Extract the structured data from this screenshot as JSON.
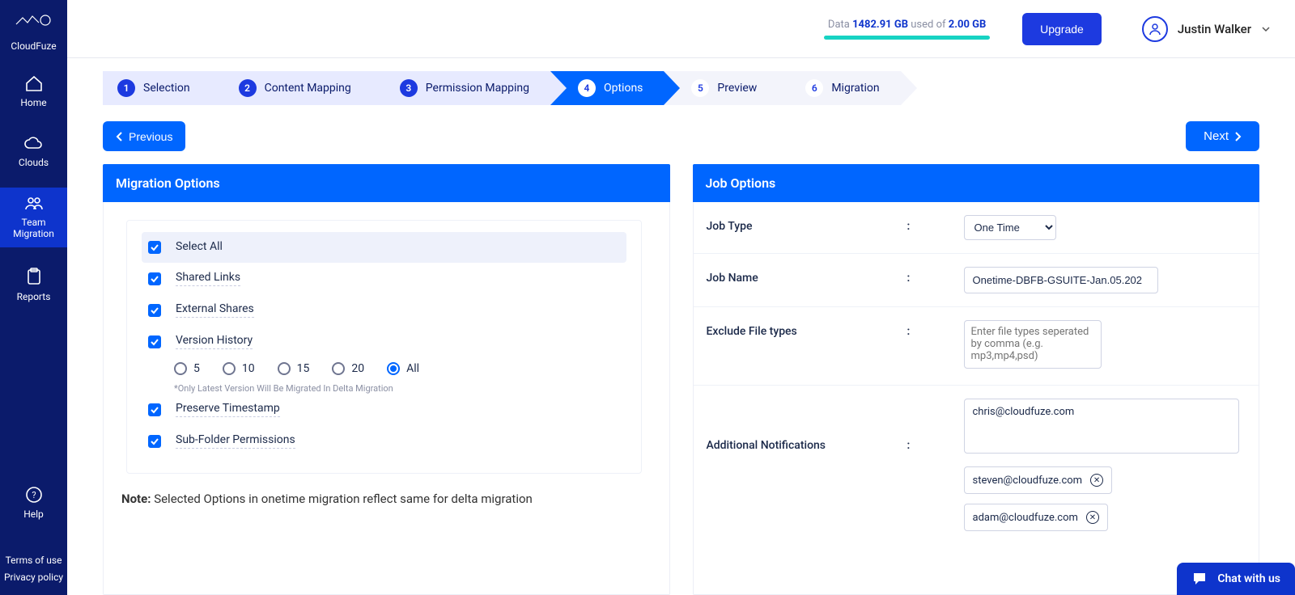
{
  "brand": "CloudFuze",
  "sidebar": {
    "items": [
      {
        "label": "Home"
      },
      {
        "label": "Clouds"
      },
      {
        "label": "Team Migration"
      },
      {
        "label": "Reports"
      }
    ],
    "help": "Help",
    "terms": "Terms of use",
    "privacy": "Privacy policy"
  },
  "topbar": {
    "data_word": "Data",
    "used_amount": "1482.91 GB",
    "used_word": "used of",
    "total": "2.00 GB",
    "upgrade": "Upgrade",
    "user": "Justin Walker"
  },
  "steps": [
    {
      "num": "1",
      "label": "Selection",
      "state": "done"
    },
    {
      "num": "2",
      "label": "Content Mapping",
      "state": "done"
    },
    {
      "num": "3",
      "label": "Permission Mapping",
      "state": "done"
    },
    {
      "num": "4",
      "label": "Options",
      "state": "active"
    },
    {
      "num": "5",
      "label": "Preview",
      "state": "pending"
    },
    {
      "num": "6",
      "label": "Migration",
      "state": "pending"
    }
  ],
  "buttons": {
    "previous": "Previous",
    "next": "Next"
  },
  "migration": {
    "title": "Migration Options",
    "select_all": "Select All",
    "shared_links": "Shared Links",
    "external_shares": "External Shares",
    "version_history": "Version History",
    "version_options": {
      "v5": "5",
      "v10": "10",
      "v15": "15",
      "v20": "20",
      "all": "All"
    },
    "version_selected": "All",
    "version_note": "*Only Latest Version Will Be Migrated In Delta Migration",
    "preserve_timestamp": "Preserve Timestamp",
    "subfolder_perm": "Sub-Folder Permissions",
    "note_label": "Note:",
    "note_text": "Selected Options in onetime migration reflect same for delta migration"
  },
  "job": {
    "title": "Job Options",
    "type_label": "Job Type",
    "type_value": "One Time",
    "name_label": "Job Name",
    "name_value": "Onetime-DBFB-GSUITE-Jan.05.202",
    "exclude_label": "Exclude File types",
    "exclude_placeholder": "Enter file types seperated by comma (e.g. mp3,mp4,psd)",
    "notif_label": "Additional Notifications",
    "notif_main": "chris@cloudfuze.com",
    "notif_tags": [
      "steven@cloudfuze.com",
      "adam@cloudfuze.com"
    ]
  },
  "chat": "Chat with us"
}
